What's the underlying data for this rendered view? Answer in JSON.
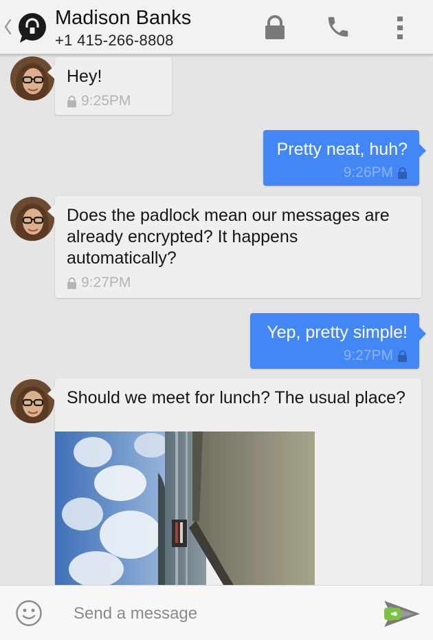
{
  "header": {
    "contact_name": "Madison Banks",
    "contact_number": "+1 415-266-8808",
    "icons": {
      "back": "chevron-left-icon",
      "app_logo": "signal-lock-logo",
      "secure": "lock-icon",
      "call": "phone-icon",
      "overflow": "more-vert-icon"
    }
  },
  "messages": [
    {
      "direction": "incoming",
      "text": "Hey!",
      "time": "9:25PM",
      "secure": true
    },
    {
      "direction": "outgoing",
      "text": "Pretty neat, huh?",
      "time": "9:26PM",
      "secure": true
    },
    {
      "direction": "incoming",
      "text": "Does the padlock mean our messages are already encrypted? It happens automatically?",
      "time": "9:27PM",
      "secure": true
    },
    {
      "direction": "outgoing",
      "text": "Yep, pretty simple!",
      "time": "9:27PM",
      "secure": true
    },
    {
      "direction": "incoming",
      "text": "Should we meet for lunch? The usual place?",
      "attachment": "image-pier-lake-photo"
    }
  ],
  "compose": {
    "placeholder": "Send a message",
    "icons": {
      "emoji": "emoji-smile-icon",
      "send": "send-secure-icon"
    }
  },
  "colors": {
    "outgoing_bubble": "#4287f5",
    "incoming_bubble": "#efefef",
    "background": "#e5e5e5",
    "send_accent": "#7cc142"
  }
}
